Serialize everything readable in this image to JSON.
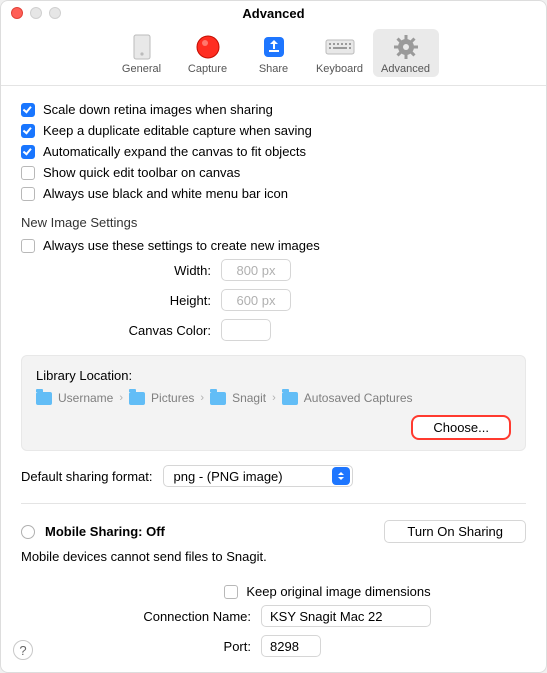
{
  "title": "Advanced",
  "tabs": {
    "general": "General",
    "capture": "Capture",
    "share": "Share",
    "keyboard": "Keyboard",
    "advanced": "Advanced"
  },
  "checks": {
    "scale_down": "Scale down retina images when sharing",
    "keep_dup": "Keep a duplicate editable capture when saving",
    "auto_expand": "Automatically expand the canvas to fit objects",
    "quick_edit": "Show quick edit toolbar on canvas",
    "bw_menubar": "Always use black and white menu bar icon"
  },
  "new_image": {
    "section": "New Image Settings",
    "always_use": "Always use these settings to create new images",
    "width_label": "Width:",
    "width_placeholder": "800 px",
    "height_label": "Height:",
    "height_placeholder": "600 px",
    "canvas_color_label": "Canvas Color:"
  },
  "library": {
    "label": "Library Location:",
    "crumbs": [
      "Username",
      "Pictures",
      "Snagit",
      "Autosaved Captures"
    ],
    "choose": "Choose..."
  },
  "default_format": {
    "label": "Default sharing format:",
    "value": "png - (PNG image)"
  },
  "mobile": {
    "heading": "Mobile Sharing: Off",
    "turn_on": "Turn On Sharing",
    "note": "Mobile devices cannot send files to Snagit.",
    "keep_original": "Keep original image dimensions",
    "conn_label": "Connection Name:",
    "conn_value": "KSY Snagit Mac 22",
    "port_label": "Port:",
    "port_value": "8298"
  },
  "help": "?"
}
